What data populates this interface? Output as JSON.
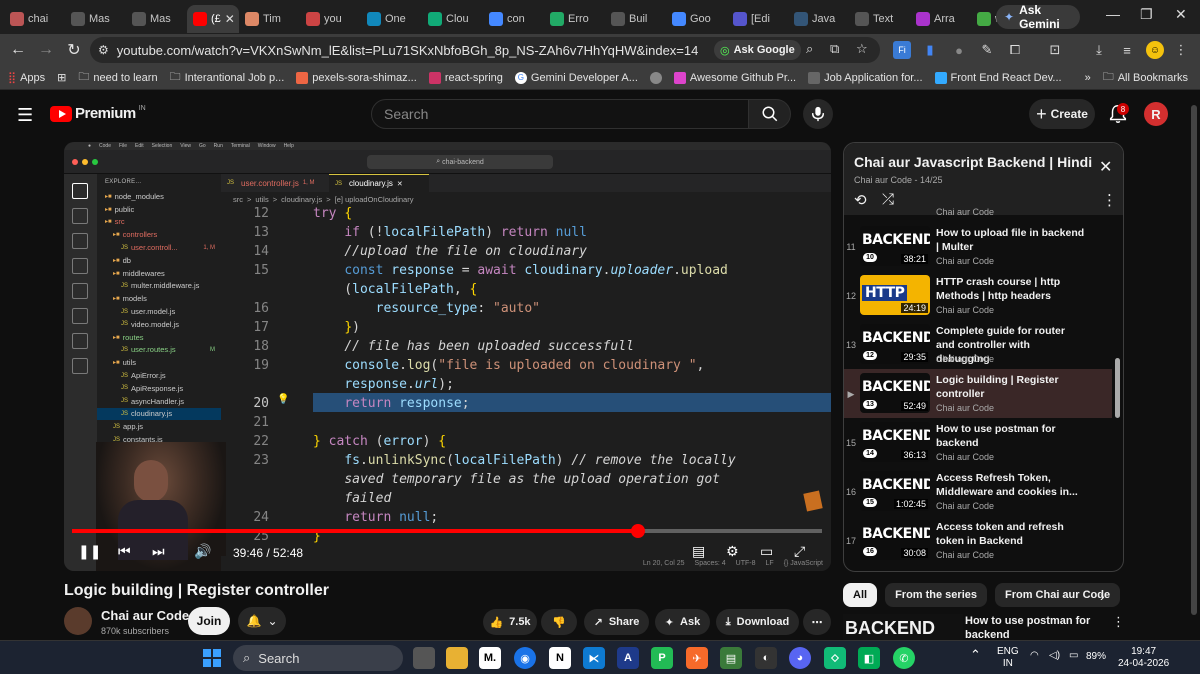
{
  "browser": {
    "tabs": [
      {
        "label": "chai",
        "color": "#b55"
      },
      {
        "label": "Mas",
        "color": "#555"
      },
      {
        "label": "Mas",
        "color": "#555"
      },
      {
        "label": "(£",
        "color": "#f00",
        "active": true
      },
      {
        "label": "Tim",
        "color": "#d86"
      },
      {
        "label": "you",
        "color": "#c44"
      },
      {
        "label": "One",
        "color": "#18b"
      },
      {
        "label": "Clou",
        "color": "#1a7"
      },
      {
        "label": "con",
        "color": "#48f"
      },
      {
        "label": "Erro",
        "color": "#2a6"
      },
      {
        "label": "Buil",
        "color": "#555"
      },
      {
        "label": "Goo",
        "color": "#48f"
      },
      {
        "label": "[Edi",
        "color": "#55c"
      },
      {
        "label": "Java",
        "color": "#357"
      },
      {
        "label": "Text",
        "color": "#555"
      },
      {
        "label": "Arra",
        "color": "#a3c"
      },
      {
        "label": "wha",
        "color": "#4a4"
      }
    ],
    "ask_gemini": "Ask Gemini",
    "url": "youtube.com/watch?v=VKXnSwNm_lE&list=PLu71SKxNbfoBGh_8p_NS-ZAh6v7HhYqHW&index=14",
    "ask_google": "Ask Google",
    "bookmarks": [
      {
        "label": "Apps",
        "color": "#888"
      },
      {
        "label": "need to learn",
        "color": "#aaa"
      },
      {
        "label": "Interantional Job p...",
        "color": "#aaa"
      },
      {
        "label": "pexels-sora-shimaz...",
        "color": "#e64"
      },
      {
        "label": "react-spring",
        "color": "#c36"
      },
      {
        "label": "Gemini Developer A...",
        "color": "#4a8"
      },
      {
        "label": "",
        "color": "#888"
      },
      {
        "label": "Awesome Github Pr...",
        "color": "#d4c"
      },
      {
        "label": "Job Application for...",
        "color": "#666"
      },
      {
        "label": "Front End React Dev...",
        "color": "#3af"
      }
    ],
    "all_bookmarks": "All Bookmarks"
  },
  "youtube": {
    "premium": "Premium",
    "country": "IN",
    "search_placeholder": "Search",
    "create": "Create",
    "notif_count": "8",
    "avatar_letter": "R"
  },
  "vscode": {
    "command_center": "chai-backend",
    "explorer_title": "EXPLORE...",
    "tree": [
      {
        "name": "node_modules",
        "type": "folder",
        "indent": 1
      },
      {
        "name": "public",
        "type": "folder",
        "indent": 1
      },
      {
        "name": "src",
        "type": "folder",
        "indent": 1,
        "color": "#e06c60"
      },
      {
        "name": "controllers",
        "type": "folder",
        "indent": 2,
        "color": "#e06c60"
      },
      {
        "name": "user.controll...",
        "type": "js",
        "indent": 3,
        "color": "#e06c60",
        "badge": "1, M"
      },
      {
        "name": "db",
        "type": "folder",
        "indent": 2
      },
      {
        "name": "middlewares",
        "type": "folder",
        "indent": 2
      },
      {
        "name": "multer.middleware.js",
        "type": "js",
        "indent": 3
      },
      {
        "name": "models",
        "type": "folder",
        "indent": 2
      },
      {
        "name": "user.model.js",
        "type": "js",
        "indent": 3
      },
      {
        "name": "video.model.js",
        "type": "js",
        "indent": 3
      },
      {
        "name": "routes",
        "type": "folder",
        "indent": 2,
        "color": "#89d185"
      },
      {
        "name": "user.routes.js",
        "type": "js",
        "indent": 3,
        "color": "#89d185",
        "badge": "M"
      },
      {
        "name": "utils",
        "type": "folder",
        "indent": 2
      },
      {
        "name": "ApiError.js",
        "type": "js",
        "indent": 3
      },
      {
        "name": "ApiResponse.js",
        "type": "js",
        "indent": 3
      },
      {
        "name": "asyncHandler.js",
        "type": "js",
        "indent": 3
      },
      {
        "name": "cloudinary.js",
        "type": "js",
        "indent": 3,
        "selected": true
      },
      {
        "name": "app.js",
        "type": "js",
        "indent": 2
      },
      {
        "name": "constants.js",
        "type": "js",
        "indent": 2
      },
      {
        "name": "index.js",
        "type": "js",
        "indent": 2
      }
    ],
    "editor_tabs": [
      {
        "label": "user.controller.js",
        "badge": "1, M",
        "color": "#e06c60"
      },
      {
        "label": "cloudinary.js",
        "active": true
      }
    ],
    "breadcrumbs": [
      "src",
      ">",
      "utils",
      ">",
      "cloudinary.js",
      ">",
      "[e] uploadOnCloudinary"
    ],
    "status_items": [
      "Ln 20, Col 25",
      "Spaces: 4",
      "UTF-8",
      "LF",
      "{} JavaScript"
    ],
    "line_numbers": [
      "12",
      "13",
      "14",
      "15",
      "",
      "16",
      "17",
      "18",
      "19",
      "",
      "20",
      "21",
      "22",
      "23",
      "",
      "",
      "24",
      "25"
    ],
    "active_line": "20"
  },
  "player": {
    "progress_fraction": 0.755,
    "time": "39:46 / 52:48"
  },
  "video": {
    "title": "Logic building | Register controller",
    "channel": "Chai aur Code",
    "subscribers": "870k subscribers",
    "join": "Join",
    "likes": "7.5k",
    "share": "Share",
    "ask": "Ask",
    "download": "Download"
  },
  "playlist": {
    "title": "Chai aur Javascript Backend | Hindi",
    "meta": "Chai aur Code - 14/25",
    "top_partial": "Chai aur Code",
    "items": [
      {
        "index": "11",
        "title": "How to upload file in backend | Multer",
        "channel": "Chai aur Code",
        "duration": "38:21",
        "ep": "10",
        "thumb": "BACKEND"
      },
      {
        "index": "12",
        "title": "HTTP crash course | http Methods | http headers",
        "channel": "Chai aur Code",
        "duration": "24:19",
        "ep": "",
        "thumb": "HTTP"
      },
      {
        "index": "13",
        "title": "Complete guide for router and controller with debugging",
        "channel": "Chai aur Code",
        "duration": "29:35",
        "ep": "12",
        "thumb": "BACKEND"
      },
      {
        "index": "▶",
        "title": "Logic building | Register controller",
        "channel": "Chai aur Code",
        "duration": "52:49",
        "ep": "13",
        "thumb": "BACKEND",
        "active": true
      },
      {
        "index": "15",
        "title": "How to use postman for backend",
        "channel": "Chai aur Code",
        "duration": "36:13",
        "ep": "14",
        "thumb": "BACKEND"
      },
      {
        "index": "16",
        "title": "Access Refresh Token, Middleware and cookies in...",
        "channel": "Chai aur Code",
        "duration": "1:02:45",
        "ep": "15",
        "thumb": "BACKEND"
      },
      {
        "index": "17",
        "title": "Access token and refresh token in Backend",
        "channel": "Chai aur Code",
        "duration": "30:08",
        "ep": "16",
        "thumb": "BACKEND"
      }
    ],
    "chips": [
      "All",
      "From the series",
      "From Chai aur Code"
    ],
    "next_title": "How to use postman for backend",
    "next_thumb": "BACKEND"
  },
  "taskbar": {
    "search": "Search",
    "lang": "ENG",
    "region": "IN",
    "battery": "89%",
    "time": "19:47",
    "date": "24-04-2026"
  }
}
